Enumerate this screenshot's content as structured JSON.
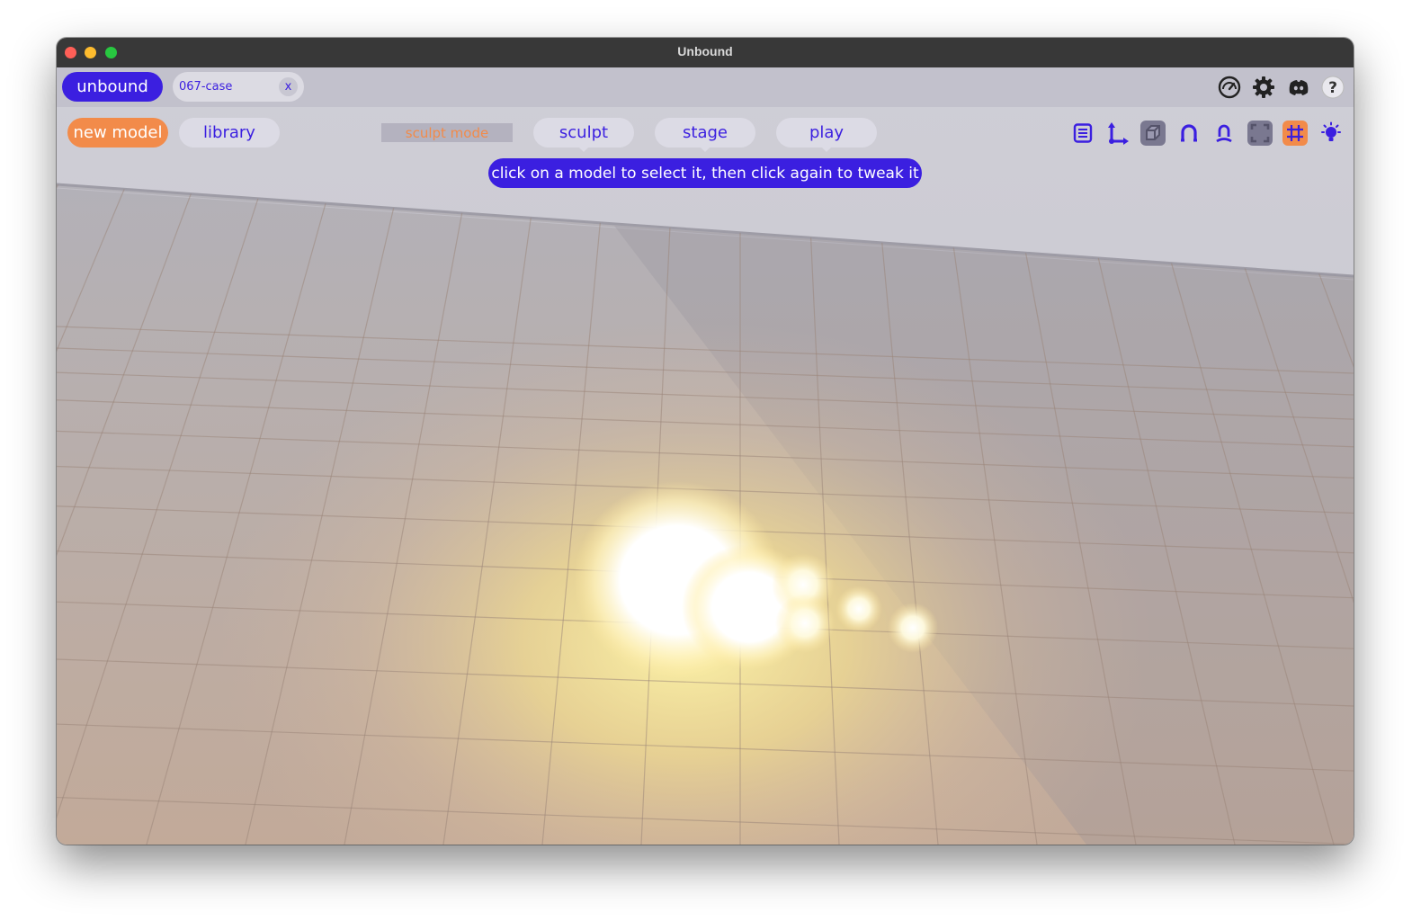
{
  "window": {
    "title": "Unbound"
  },
  "header": {
    "app_name": "unbound",
    "file_tab": {
      "name": "067-case",
      "close_label": "x"
    },
    "icons": [
      "speedometer-icon",
      "settings-gear-icon",
      "discord-icon",
      "help-icon"
    ]
  },
  "toolbar": {
    "new_model_label": "new model",
    "library_label": "library",
    "mode_label": "sculpt mode",
    "modes": [
      "sculpt",
      "stage",
      "play"
    ],
    "tools": [
      "properties-panel-icon",
      "axes-gizmo-icon",
      "cube-view-icon",
      "magnet-snap-icon",
      "attach-icon",
      "frame-fullscreen-icon",
      "grid-icon",
      "light-icon"
    ]
  },
  "hint": {
    "text": "click on a model to select it, then click again to tweak it"
  },
  "colors": {
    "accent": "#3b1fe0",
    "orange": "#f28b4a",
    "pill_bg": "#dcdbe5",
    "toolbar_bg": "#c2c1cc"
  }
}
